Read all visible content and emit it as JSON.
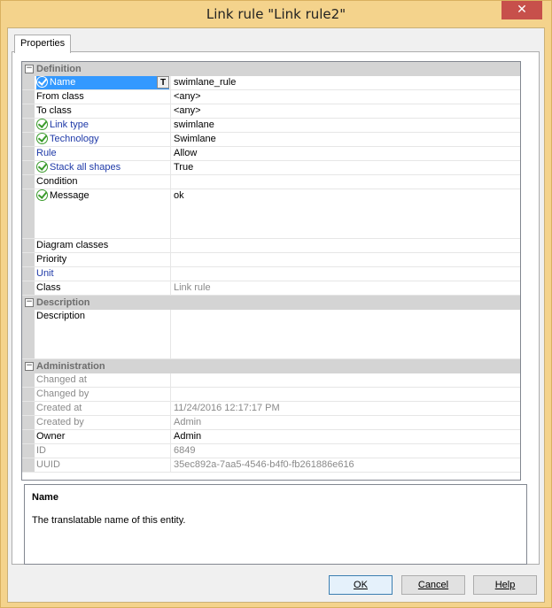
{
  "window": {
    "title": "Link rule \"Link rule2\"",
    "close_label": "✕"
  },
  "tab": {
    "label": "Properties"
  },
  "categories": {
    "definition": "Definition",
    "description": "Description",
    "administration": "Administration",
    "toggle": "−"
  },
  "definition": {
    "name": {
      "label": "Name",
      "value": "swimlane_rule",
      "translate_button": "T"
    },
    "from_class": {
      "label": "From class",
      "value": "<any>"
    },
    "to_class": {
      "label": "To class",
      "value": "<any>"
    },
    "link_type": {
      "label": "Link type",
      "value": "swimlane"
    },
    "technology": {
      "label": "Technology",
      "value": "Swimlane"
    },
    "rule": {
      "label": "Rule",
      "value": "Allow"
    },
    "stack_all_shapes": {
      "label": "Stack all shapes",
      "value": "True"
    },
    "condition": {
      "label": "Condition",
      "value": ""
    },
    "message": {
      "label": "Message",
      "value": "ok"
    },
    "diagram_classes": {
      "label": "Diagram classes",
      "value": ""
    },
    "priority": {
      "label": "Priority",
      "value": ""
    },
    "unit": {
      "label": "Unit",
      "value": ""
    },
    "class": {
      "label": "Class",
      "value": "Link rule"
    }
  },
  "description": {
    "description": {
      "label": "Description",
      "value": ""
    }
  },
  "administration": {
    "changed_at": {
      "label": "Changed at",
      "value": ""
    },
    "changed_by": {
      "label": "Changed by",
      "value": ""
    },
    "created_at": {
      "label": "Created at",
      "value": "11/24/2016 12:17:17 PM"
    },
    "created_by": {
      "label": "Created by",
      "value": "Admin"
    },
    "owner": {
      "label": "Owner",
      "value": "Admin"
    },
    "id": {
      "label": "ID",
      "value": "6849"
    },
    "uuid": {
      "label": "UUID",
      "value": "35ec892a-7aa5-4546-b4f0-fb261886e616"
    }
  },
  "help": {
    "title": "Name",
    "text": "The translatable name of this entity."
  },
  "buttons": {
    "ok": "OK",
    "cancel": "Cancel",
    "help": "Help"
  },
  "colors": {
    "title_bar": "#f4d38c",
    "selection": "#3399ff",
    "check": "#3a9b2b",
    "link_label": "#1f3aa8"
  },
  "icons": {
    "check": "check-circle-icon",
    "toggle": "collapse-icon",
    "close": "close-icon"
  }
}
